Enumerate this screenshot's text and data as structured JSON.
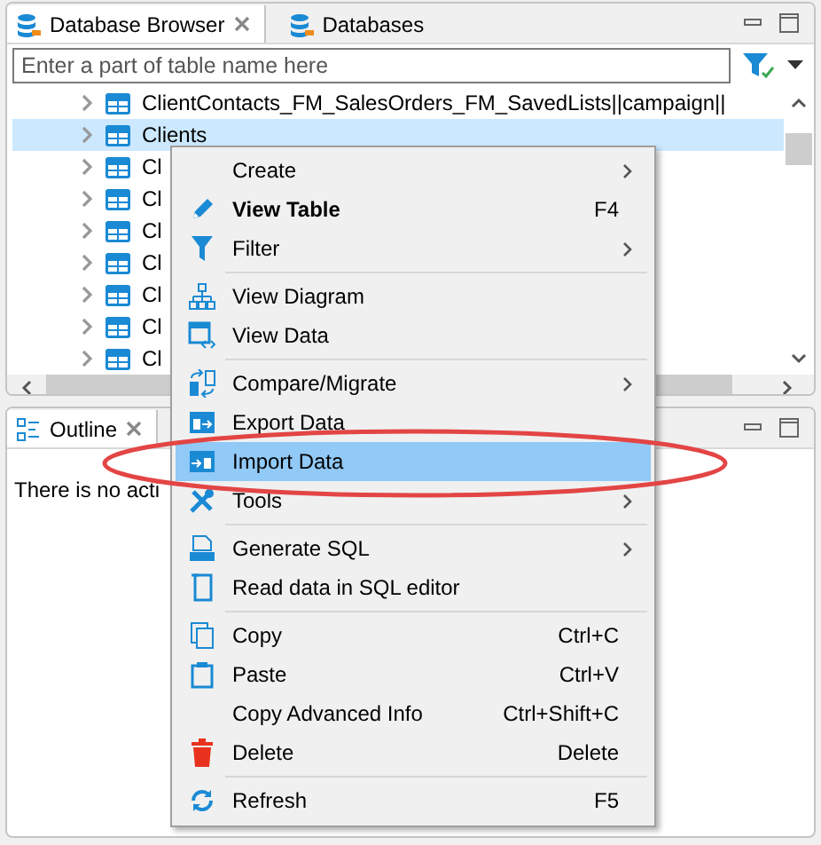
{
  "top_panel": {
    "tabs": [
      {
        "label": "Database Browser",
        "selected": true
      },
      {
        "label": "Databases",
        "selected": false
      }
    ],
    "filter": {
      "placeholder": "Enter a part of table name here"
    },
    "tree": [
      {
        "label": "ClientContacts_FM_SalesOrders_FM_SavedLists||campaign||",
        "selected": false
      },
      {
        "label": "Clients",
        "selected": true
      },
      {
        "label": "Cl",
        "selected": false
      },
      {
        "label": "Cl",
        "selected": false
      },
      {
        "label": "Cl",
        "selected": false
      },
      {
        "label": "Cl",
        "selected": false
      },
      {
        "label": "Cl",
        "selected": false
      },
      {
        "label": "Cl",
        "selected": false
      },
      {
        "label": "Cl",
        "selected": false
      }
    ]
  },
  "outline_panel": {
    "tab": {
      "label": "Outline",
      "selected": true
    },
    "message": "There is no acti"
  },
  "context_menu": [
    {
      "kind": "item",
      "label": "Create",
      "submenu": true,
      "bold": false,
      "selected": false
    },
    {
      "kind": "item",
      "label": "View Table",
      "shortcut": "F4",
      "submenu": false,
      "bold": true,
      "selected": false
    },
    {
      "kind": "item",
      "label": "Filter",
      "submenu": true,
      "bold": false,
      "selected": false
    },
    {
      "kind": "separator"
    },
    {
      "kind": "item",
      "label": "View Diagram",
      "submenu": false,
      "bold": false,
      "selected": false
    },
    {
      "kind": "item",
      "label": "View Data",
      "submenu": false,
      "bold": false,
      "selected": false
    },
    {
      "kind": "separator"
    },
    {
      "kind": "item",
      "label": "Compare/Migrate",
      "submenu": true,
      "bold": false,
      "selected": false
    },
    {
      "kind": "item",
      "label": "Export Data",
      "submenu": false,
      "bold": false,
      "selected": false
    },
    {
      "kind": "item",
      "label": "Import Data",
      "submenu": false,
      "bold": false,
      "selected": true
    },
    {
      "kind": "item",
      "label": "Tools",
      "submenu": true,
      "bold": false,
      "selected": false
    },
    {
      "kind": "separator"
    },
    {
      "kind": "item",
      "label": "Generate SQL",
      "submenu": true,
      "bold": false,
      "selected": false
    },
    {
      "kind": "item",
      "label": "Read data in SQL editor",
      "submenu": false,
      "bold": false,
      "selected": false
    },
    {
      "kind": "separator"
    },
    {
      "kind": "item",
      "label": "Copy",
      "shortcut": "Ctrl+C",
      "submenu": false,
      "bold": false,
      "selected": false
    },
    {
      "kind": "item",
      "label": "Paste",
      "shortcut": "Ctrl+V",
      "submenu": false,
      "bold": false,
      "selected": false
    },
    {
      "kind": "item",
      "label": "Copy Advanced Info",
      "shortcut": "Ctrl+Shift+C",
      "submenu": false,
      "bold": false,
      "selected": false
    },
    {
      "kind": "item",
      "label": "Delete",
      "shortcut": "Delete",
      "submenu": false,
      "bold": false,
      "selected": false
    },
    {
      "kind": "separator"
    },
    {
      "kind": "item",
      "label": "Refresh",
      "shortcut": "F5",
      "submenu": false,
      "bold": false,
      "selected": false
    }
  ]
}
